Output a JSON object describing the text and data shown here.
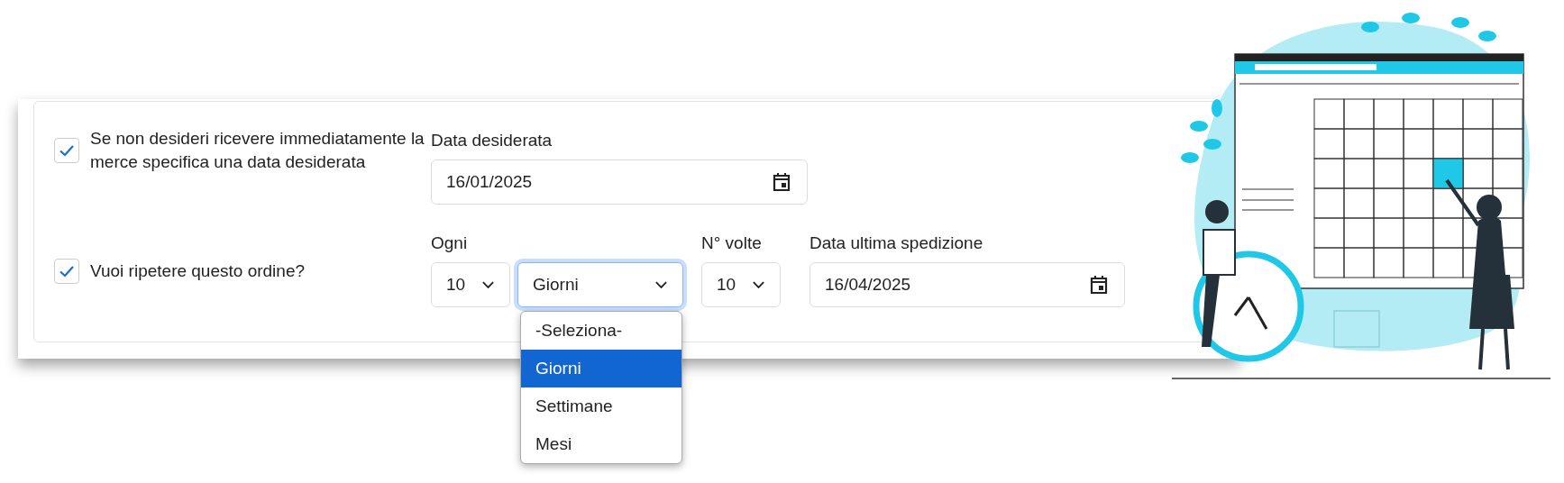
{
  "desired_date": {
    "checkbox": {
      "label": "Se non desideri ricevere immediatamente la merce specifica una data desiderata",
      "checked": true
    },
    "field": {
      "label": "Data desiderata",
      "value": "16/01/2025"
    }
  },
  "repeat": {
    "checkbox": {
      "label": "Vuoi ripetere questo ordine?",
      "checked": true
    },
    "every": {
      "label": "Ogni",
      "value": "10"
    },
    "unit": {
      "value": "Giorni",
      "expanded": true,
      "options": [
        {
          "label": "-Seleziona-",
          "selected": false
        },
        {
          "label": "Giorni",
          "selected": true
        },
        {
          "label": "Settimane",
          "selected": false
        },
        {
          "label": "Mesi",
          "selected": false
        }
      ]
    },
    "times": {
      "label": "N° volte",
      "value": "10"
    },
    "last_date": {
      "label": "Data ultima spedizione",
      "value": "16/04/2025"
    }
  }
}
